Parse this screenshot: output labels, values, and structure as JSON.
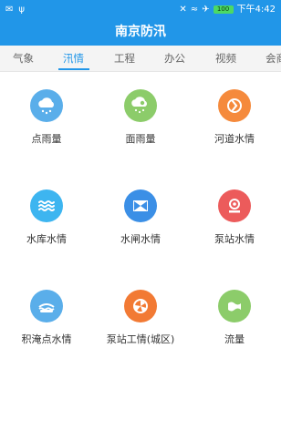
{
  "status_bar": {
    "time": "下午4:42",
    "battery": "100"
  },
  "header": {
    "title": "南京防汛"
  },
  "tabs": [
    {
      "label": "气象",
      "active": false
    },
    {
      "label": "汛情",
      "active": true
    },
    {
      "label": "工程",
      "active": false
    },
    {
      "label": "办公",
      "active": false
    },
    {
      "label": "视频",
      "active": false
    },
    {
      "label": "会商",
      "active": false
    }
  ],
  "grid": [
    {
      "label": "点雨量",
      "icon": "cloud-rain-icon",
      "color": "#5aaeea"
    },
    {
      "label": "面雨量",
      "icon": "cloud-rain-area-icon",
      "color": "#8ccc6a"
    },
    {
      "label": "河道水情",
      "icon": "river-icon",
      "color": "#f58a3c"
    },
    {
      "label": "水库水情",
      "icon": "waves-icon",
      "color": "#3db5f0"
    },
    {
      "label": "水闸水情",
      "icon": "sluice-icon",
      "color": "#3b8fe6"
    },
    {
      "label": "泵站水情",
      "icon": "pump-icon",
      "color": "#ec5b5b"
    },
    {
      "label": "积淹点水情",
      "icon": "flood-point-icon",
      "color": "#5aaeea"
    },
    {
      "label": "泵站工情(城区)",
      "icon": "pump-work-icon",
      "color": "#f27a34"
    },
    {
      "label": "流量",
      "icon": "flow-icon",
      "color": "#8ccc6a"
    }
  ]
}
